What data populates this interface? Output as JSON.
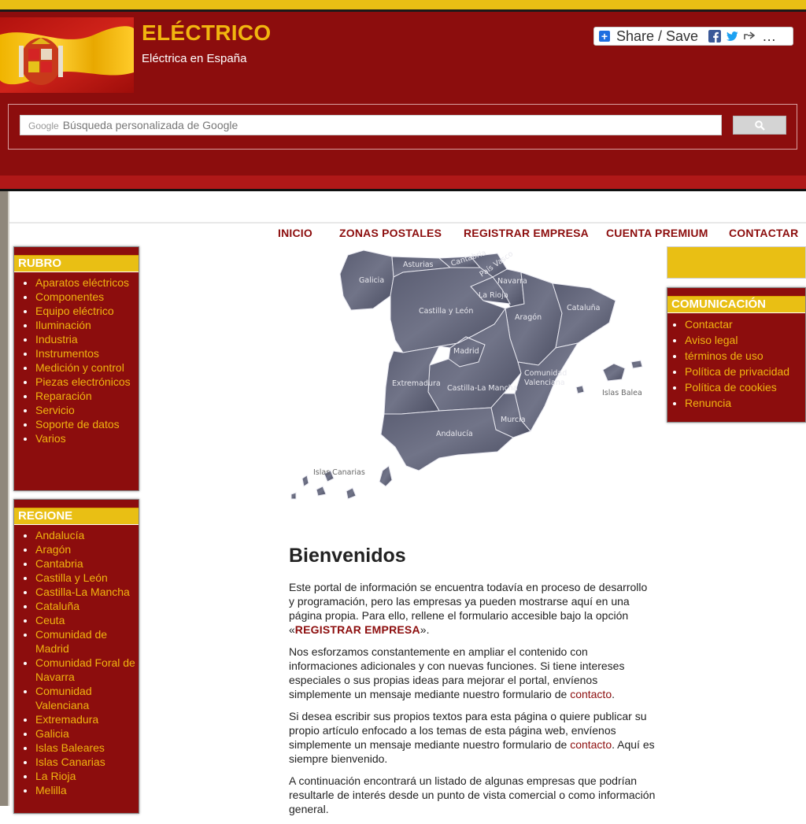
{
  "header": {
    "title": "ELÉCTRICO",
    "subtitle": "Eléctrica en España",
    "share_label": "Share / Save",
    "share_more": "…",
    "search_brand": "Google",
    "search_placeholder": "Búsqueda personalizada de Google"
  },
  "nav": {
    "items": [
      "INICIO",
      "ZONAS POSTALES",
      "REGISTRAR EMPRESA",
      "CUENTA PREMIUM",
      "CONTACTAR"
    ]
  },
  "rubro": {
    "title": "RUBRO",
    "items": [
      "Aparatos eléctricos",
      "Componentes",
      "Equipo eléctrico",
      "Iluminación",
      "Industria",
      "Instrumentos",
      "Medición y control",
      "Piezas electrónicos",
      "Reparación",
      "Servicio",
      "Soporte de datos",
      "Varios"
    ]
  },
  "regione": {
    "title": "REGIONE",
    "items": [
      "Andalucía",
      "Aragón",
      "Cantabria",
      "Castilla y León",
      "Castilla-La Mancha",
      "Cataluña",
      "Ceuta",
      "Comunidad de Madrid",
      "Comunidad Foral de Navarra",
      "Comunidad Valenciana",
      "Extremadura",
      "Galicia",
      "Islas Baleares",
      "Islas Canarias",
      "La Rioja",
      "Melilla"
    ]
  },
  "comunicacion": {
    "title": "COMUNICACIÓN",
    "items": [
      "Contactar",
      "Aviso legal",
      "términos de uso",
      "Política de privacidad",
      "Política de cookies",
      "Renuncia"
    ]
  },
  "map": {
    "labels": {
      "galicia": "Galicia",
      "asturias": "Asturias",
      "cantabria": "Cantabria",
      "pais_vasco": "País Vasco",
      "navarra": "Navarra",
      "la_rioja": "La Rioja",
      "castilla_leon": "Castilla y León",
      "aragon": "Aragón",
      "cataluna": "Cataluña",
      "madrid": "Madrid",
      "extremadura": "Extremadura",
      "castilla_mancha": "Castilla-La Mancha",
      "comunidad": "Comunidad",
      "valenciana": "Valenciana",
      "islas_balea": "Islas Balea",
      "murcia": "Murcia",
      "andalucia": "Andalucía",
      "islas_canarias": "Islas Canarias"
    }
  },
  "content": {
    "heading": "Bienvenidos",
    "p1_text": "Este portal de información se encuentra todavía en proceso de desarrollo y programación, pero las empresas ya pueden mostrarse aquí en una página propia. Para ello, rellene el formulario accesible bajo la opción «",
    "p1_link": "REGISTRAR EMPRESA",
    "p1_end": "».",
    "p2_text": "Nos esforzamos constantemente en ampliar el contenido con informaciones adicionales y con nuevas funciones. Si tiene intereses especiales o sus propias ideas para mejorar el portal, envíenos simplemente un mensaje mediante nuestro formulario de ",
    "p2_link": "contacto",
    "p2_end": ".",
    "p3_text": "Si desea escribir sus propios textos para esta página o quiere publicar su propio artículo enfocado a los temas de esta página web, envíenos simplemente un mensaje mediante nuestro formulario de ",
    "p3_link": "contacto",
    "p3_end": ". Aquí es siempre bienvenido.",
    "p4_text": "A continuación encontrará un listado de algunas empresas que podrían resultarle de interés desde un punto de vista comercial o como información general."
  },
  "colors": {
    "brand_red": "#8c0d0d",
    "brand_yellow": "#e9bf14",
    "link_yellow": "#f1b50f"
  },
  "icons": [
    "plus-icon",
    "facebook-icon",
    "twitter-icon",
    "share-arrow-icon",
    "search-icon"
  ]
}
